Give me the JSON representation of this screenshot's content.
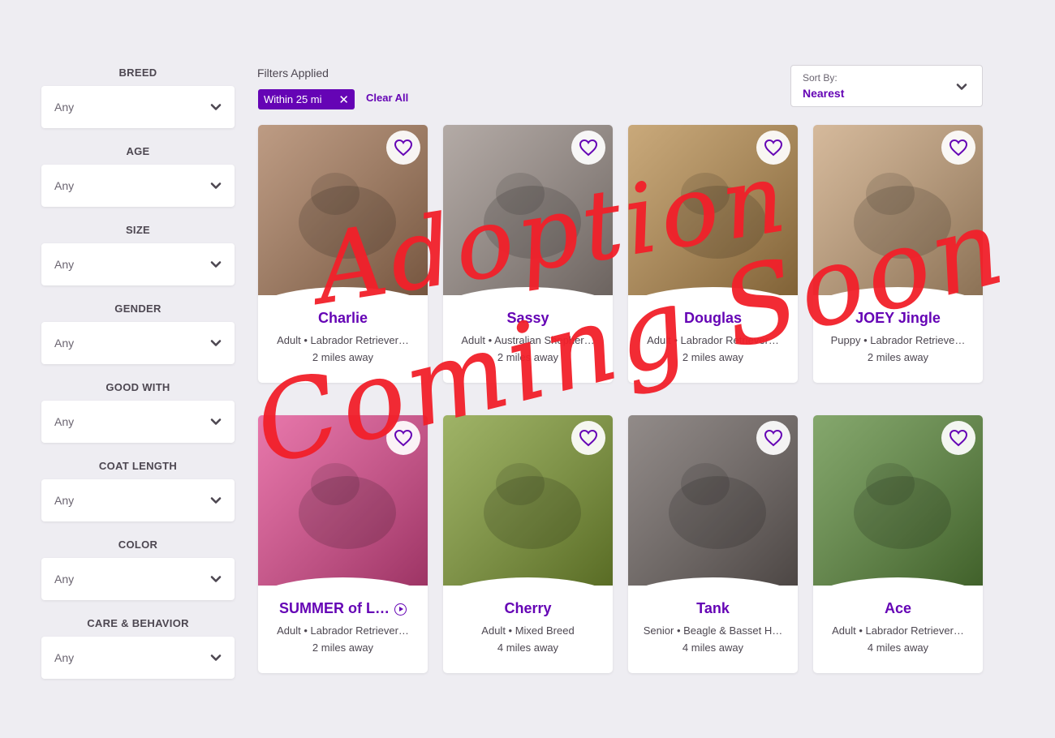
{
  "sidebar": {
    "filters": [
      {
        "label": "BREED",
        "value": "Any"
      },
      {
        "label": "AGE",
        "value": "Any"
      },
      {
        "label": "SIZE",
        "value": "Any"
      },
      {
        "label": "GENDER",
        "value": "Any"
      },
      {
        "label": "GOOD WITH",
        "value": "Any"
      },
      {
        "label": "COAT LENGTH",
        "value": "Any"
      },
      {
        "label": "COLOR",
        "value": "Any"
      },
      {
        "label": "CARE & BEHAVIOR",
        "value": "Any"
      }
    ]
  },
  "toolbar": {
    "filters_applied_label": "Filters Applied",
    "chip_label": "Within 25 mi",
    "chip_remove": "✕",
    "clear_all": "Clear All",
    "sort_label": "Sort By:",
    "sort_value": "Nearest"
  },
  "pets": [
    {
      "name": "Charlie",
      "age": "Adult",
      "breed": "Labrador Retriever…",
      "distance": "2 miles away",
      "photo_color": "#a77a5a",
      "has_video": false
    },
    {
      "name": "Sassy",
      "age": "Adult",
      "breed": "Australian Shepher…",
      "distance": "2 miles away",
      "photo_color": "#9a8e88",
      "has_video": false
    },
    {
      "name": "Douglas",
      "age": "Adult",
      "breed": "Labrador Retriever…",
      "distance": "2 miles away",
      "photo_color": "#b78c4e",
      "has_video": false
    },
    {
      "name": "JOEY Jingle",
      "age": "Puppy",
      "breed": "Labrador Retrieve…",
      "distance": "2 miles away",
      "photo_color": "#c7a27a",
      "has_video": false
    },
    {
      "name": "SUMMER of L…",
      "age": "Adult",
      "breed": "Labrador Retriever…",
      "distance": "2 miles away",
      "photo_color": "#e04a8f",
      "has_video": true
    },
    {
      "name": "Cherry",
      "age": "Adult",
      "breed": "Mixed Breed",
      "distance": "4 miles away",
      "photo_color": "#7f9a34",
      "has_video": false
    },
    {
      "name": "Tank",
      "age": "Senior",
      "breed": "Beagle & Basset H…",
      "distance": "4 miles away",
      "photo_color": "#6d6461",
      "has_video": false
    },
    {
      "name": "Ace",
      "age": "Adult",
      "breed": "Labrador Retriever…",
      "distance": "4 miles away",
      "photo_color": "#5c8a3c",
      "has_video": false
    }
  ],
  "overlay": {
    "line1": "Adoption",
    "line2": "Coming Soon"
  },
  "colors": {
    "accent": "#6504b5",
    "background": "#eeedf2",
    "overlay": "#f2202a"
  },
  "icons": {
    "favorite": "heart-outline-icon",
    "dropdown": "chevron-down-icon",
    "remove": "close-icon",
    "video": "play-circle-icon"
  }
}
